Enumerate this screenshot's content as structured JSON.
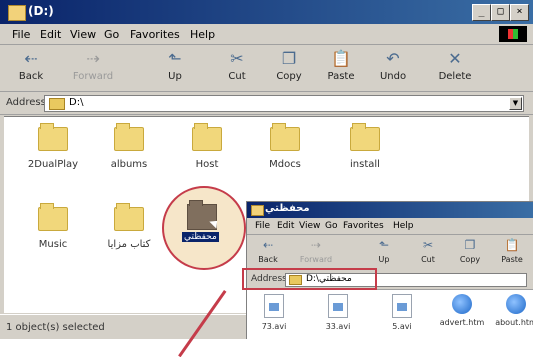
{
  "main_window": {
    "title": "(D:)",
    "controls": [
      "_",
      "□",
      "×"
    ],
    "menu": [
      "File",
      "Edit",
      "View",
      "Go",
      "Favorites",
      "Help"
    ],
    "toolbar": [
      {
        "label": "Back",
        "icon": "back-arrow-icon"
      },
      {
        "label": "Forward",
        "icon": "forward-arrow-icon",
        "disabled": true
      },
      {
        "label": "Up",
        "icon": "up-folder-icon"
      },
      {
        "label": "Cut",
        "icon": "scissors-icon"
      },
      {
        "label": "Copy",
        "icon": "copy-icon"
      },
      {
        "label": "Paste",
        "icon": "paste-icon"
      },
      {
        "label": "Undo",
        "icon": "undo-icon"
      },
      {
        "label": "Delete",
        "icon": "delete-x-icon"
      }
    ],
    "address": {
      "label": "Address",
      "value": "D:\\"
    },
    "folders_row1": [
      "2DualPlay",
      "albums",
      "Host",
      "Mdocs",
      "install"
    ],
    "folders_row2": [
      "Music",
      "كتاب مزايا"
    ],
    "dragging_label": "محفظتي",
    "status": "1 object(s) selected"
  },
  "inset_window": {
    "title": "محفظتي",
    "menu": [
      "File",
      "Edit",
      "View",
      "Go",
      "Favorites",
      "Help"
    ],
    "toolbar": [
      "Back",
      "Forward",
      "Up",
      "Cut",
      "Copy",
      "Paste"
    ],
    "address": {
      "label": "Address",
      "value": "D:\\محفظتي"
    },
    "files": [
      "73.avi",
      "33.avi",
      "5.avi",
      "advert.htm",
      "about.htm"
    ]
  },
  "colors": {
    "title_blue": "#0a246a",
    "highlight_red": "#c53c4a",
    "chrome": "#d4d0c8"
  }
}
